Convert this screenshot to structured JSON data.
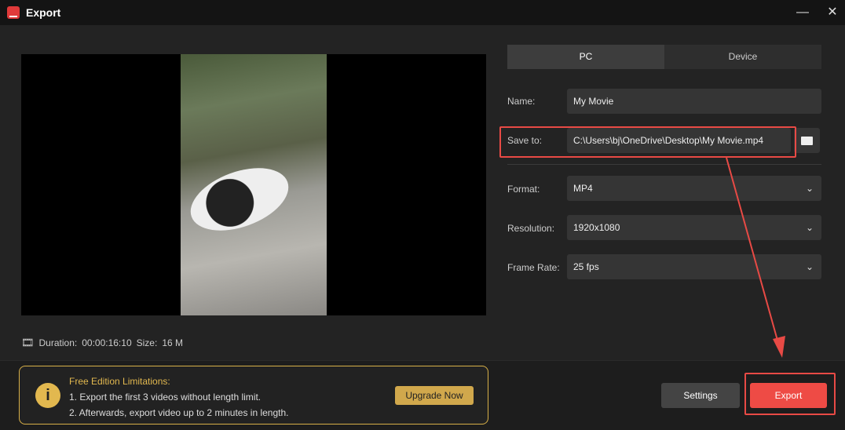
{
  "window": {
    "title": "Export",
    "minimize_icon": "minimize-icon",
    "close_icon": "close-icon"
  },
  "preview": {
    "duration_label": "Duration:",
    "duration": "00:00:16:10",
    "size_label": "Size:",
    "size": "16 M"
  },
  "tabs": [
    {
      "label": "PC",
      "active": true
    },
    {
      "label": "Device",
      "active": false
    }
  ],
  "form": {
    "name_label": "Name:",
    "name_value": "My Movie",
    "save_label": "Save to:",
    "save_value": "C:\\Users\\bj\\OneDrive\\Desktop\\My Movie.mp4",
    "format_label": "Format:",
    "format_value": "MP4",
    "resolution_label": "Resolution:",
    "resolution_value": "1920x1080",
    "framerate_label": "Frame Rate:",
    "framerate_value": "25 fps"
  },
  "notice": {
    "title": "Free Edition Limitations:",
    "line1": "1. Export the first 3 videos without length limit.",
    "line2": "2. Afterwards, export video up to 2 minutes in length.",
    "upgrade_label": "Upgrade Now"
  },
  "buttons": {
    "settings": "Settings",
    "export": "Export"
  },
  "colors": {
    "accent": "#e84a45",
    "gold": "#d8b048"
  }
}
